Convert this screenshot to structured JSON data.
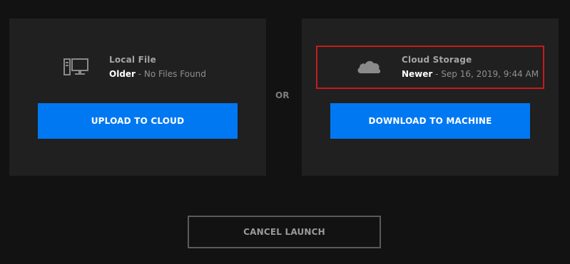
{
  "local": {
    "icon": "desktop-computer-icon",
    "title": "Local File",
    "status_tag": "Older",
    "status_detail": " - No Files Found",
    "action_label": "UPLOAD TO CLOUD"
  },
  "divider": {
    "label": "OR"
  },
  "cloud": {
    "icon": "cloud-icon",
    "title": "Cloud Storage",
    "status_tag": "Newer",
    "status_detail": " - Sep 16, 2019, 9:44 AM",
    "action_label": "DOWNLOAD TO MACHINE"
  },
  "footer": {
    "cancel_label": "CANCEL LAUNCH"
  },
  "colors": {
    "background": "#121212",
    "panel": "#202020",
    "primary": "#0078f2",
    "highlight": "#c81a1a"
  }
}
